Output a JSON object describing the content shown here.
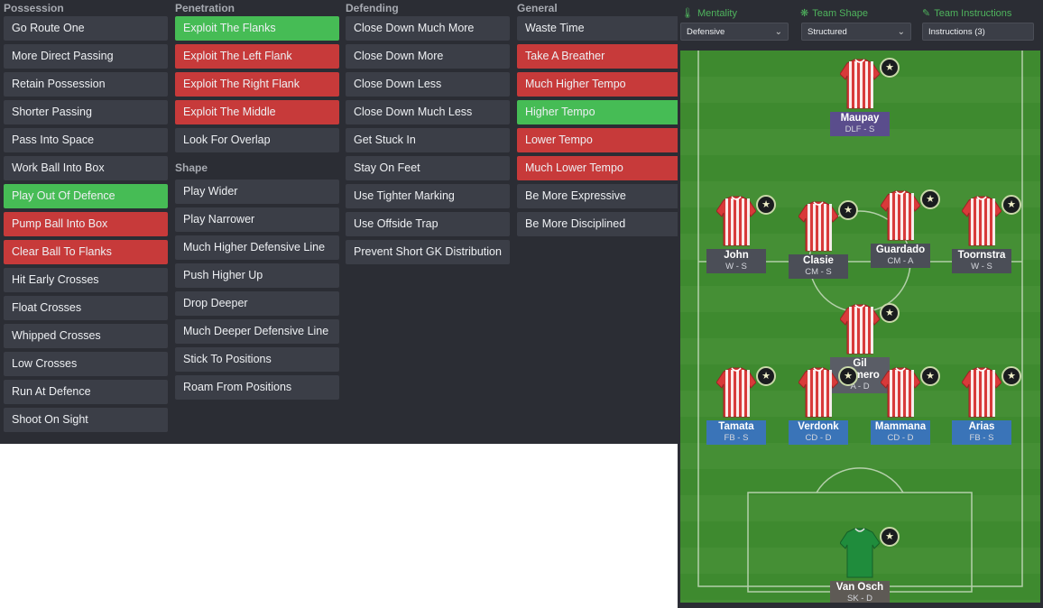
{
  "columns": {
    "possession": {
      "title": "Possession",
      "items": [
        {
          "label": "Go Route One",
          "state": "off"
        },
        {
          "label": "More Direct Passing",
          "state": "off"
        },
        {
          "label": "Retain Possession",
          "state": "off"
        },
        {
          "label": "Shorter Passing",
          "state": "off"
        },
        {
          "label": "Pass Into Space",
          "state": "off"
        },
        {
          "label": "Work Ball Into Box",
          "state": "off"
        },
        {
          "label": "Play Out Of Defence",
          "state": "on"
        },
        {
          "label": "Pump Ball Into Box",
          "state": "blocked"
        },
        {
          "label": "Clear Ball To Flanks",
          "state": "blocked"
        },
        {
          "label": "Hit Early Crosses",
          "state": "off"
        },
        {
          "label": "Float Crosses",
          "state": "off"
        },
        {
          "label": "Whipped Crosses",
          "state": "off"
        },
        {
          "label": "Low Crosses",
          "state": "off"
        },
        {
          "label": "Run At Defence",
          "state": "off"
        },
        {
          "label": "Shoot On Sight",
          "state": "off"
        }
      ]
    },
    "penetration": {
      "title": "Penetration",
      "items": [
        {
          "label": "Exploit The Flanks",
          "state": "on"
        },
        {
          "label": "Exploit The Left Flank",
          "state": "blocked"
        },
        {
          "label": "Exploit The Right Flank",
          "state": "blocked"
        },
        {
          "label": "Exploit The Middle",
          "state": "blocked"
        },
        {
          "label": "Look For Overlap",
          "state": "off"
        }
      ]
    },
    "shape": {
      "title": "Shape",
      "items": [
        {
          "label": "Play Wider",
          "state": "off"
        },
        {
          "label": "Play Narrower",
          "state": "off"
        },
        {
          "label": "Much Higher Defensive Line",
          "state": "off"
        },
        {
          "label": "Push Higher Up",
          "state": "off"
        },
        {
          "label": "Drop Deeper",
          "state": "off"
        },
        {
          "label": "Much Deeper Defensive Line",
          "state": "off"
        },
        {
          "label": "Stick To Positions",
          "state": "off"
        },
        {
          "label": "Roam From Positions",
          "state": "off"
        }
      ]
    },
    "defending": {
      "title": "Defending",
      "items": [
        {
          "label": "Close Down Much More",
          "state": "off"
        },
        {
          "label": "Close Down More",
          "state": "off"
        },
        {
          "label": "Close Down Less",
          "state": "off"
        },
        {
          "label": "Close Down Much Less",
          "state": "off"
        },
        {
          "label": "Get Stuck In",
          "state": "off"
        },
        {
          "label": "Stay On Feet",
          "state": "off"
        },
        {
          "label": "Use Tighter Marking",
          "state": "off"
        },
        {
          "label": "Use Offside Trap",
          "state": "off"
        },
        {
          "label": "Prevent Short GK Distribution",
          "state": "off"
        }
      ]
    },
    "general": {
      "title": "General",
      "items": [
        {
          "label": "Waste Time",
          "state": "off"
        },
        {
          "label": "Take A Breather",
          "state": "blocked"
        },
        {
          "label": "Much Higher Tempo",
          "state": "blocked"
        },
        {
          "label": "Higher Tempo",
          "state": "on"
        },
        {
          "label": "Lower Tempo",
          "state": "blocked"
        },
        {
          "label": "Much Lower Tempo",
          "state": "blocked"
        },
        {
          "label": "Be More Expressive",
          "state": "off"
        },
        {
          "label": "Be More Disciplined",
          "state": "off"
        }
      ]
    }
  },
  "topbar": {
    "mentality_label": "Mentality",
    "mentality_value": "Defensive",
    "shape_label": "Team Shape",
    "shape_value": "Structured",
    "instructions_label": "Team Instructions",
    "instructions_value": "Instructions (3)"
  },
  "players": [
    {
      "name": "Maupay",
      "role": "DLF - S",
      "plate": "purple"
    },
    {
      "name": "John",
      "role": "W - S",
      "plate": "dark"
    },
    {
      "name": "Clasie",
      "role": "CM - S",
      "plate": "dark"
    },
    {
      "name": "Guardado",
      "role": "CM - A",
      "plate": "dark"
    },
    {
      "name": "Toornstra",
      "role": "W - S",
      "plate": "dark"
    },
    {
      "name": "Gil Romero",
      "role": "A - D",
      "plate": "gray"
    },
    {
      "name": "Tamata",
      "role": "FB - S",
      "plate": "blue"
    },
    {
      "name": "Verdonk",
      "role": "CD - D",
      "plate": "blue"
    },
    {
      "name": "Mammana",
      "role": "CD - D",
      "plate": "blue"
    },
    {
      "name": "Arias",
      "role": "FB - S",
      "plate": "blue"
    },
    {
      "name": "Van Osch",
      "role": "SK - D",
      "plate": "gk"
    }
  ],
  "colors": {
    "green": "#46bc55",
    "red": "#c73a3a",
    "panel": "#2b2d34",
    "button": "#3b3e47",
    "shirt_red": "#d83a3a",
    "gk_green": "#1f8c3c"
  },
  "icons": {
    "mentality": "mentality-icon",
    "shape": "team-shape-icon",
    "instructions": "team-instructions-icon",
    "badge": "star-badge-icon"
  }
}
